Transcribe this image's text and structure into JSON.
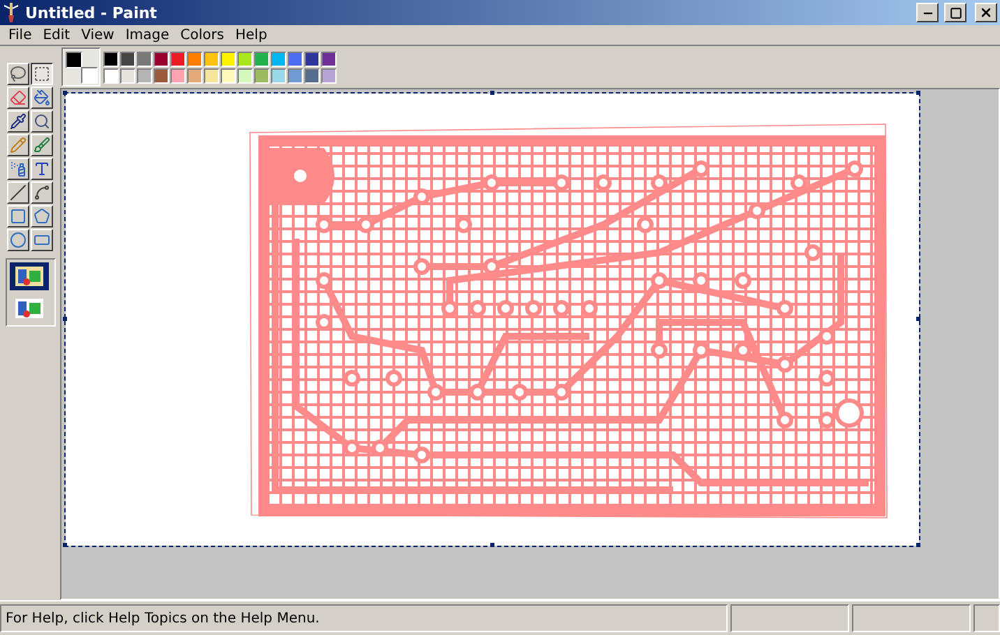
{
  "window": {
    "title": "Untitled - Paint"
  },
  "menu": [
    "File",
    "Edit",
    "View",
    "Image",
    "Colors",
    "Help"
  ],
  "tools": [
    {
      "kind": "free-select",
      "selected": false
    },
    {
      "kind": "select",
      "selected": true
    },
    {
      "kind": "eraser",
      "selected": false
    },
    {
      "kind": "fill",
      "selected": false
    },
    {
      "kind": "picker",
      "selected": false
    },
    {
      "kind": "magnifier",
      "selected": false
    },
    {
      "kind": "pencil",
      "selected": false
    },
    {
      "kind": "brush",
      "selected": false
    },
    {
      "kind": "airbrush",
      "selected": false
    },
    {
      "kind": "text",
      "selected": false
    },
    {
      "kind": "line",
      "selected": false
    },
    {
      "kind": "curve",
      "selected": false
    },
    {
      "kind": "rectangle",
      "selected": false
    },
    {
      "kind": "polygon",
      "selected": false
    },
    {
      "kind": "ellipse",
      "selected": false
    },
    {
      "kind": "rounded-rectangle",
      "selected": false
    }
  ],
  "tool_options": [
    {
      "selected": true
    },
    {
      "selected": false
    }
  ],
  "palette": [
    {
      "color": "#000000"
    },
    {
      "color": "#464646"
    },
    {
      "color": "#787878"
    },
    {
      "color": "#990030"
    },
    {
      "color": "#ed1c24"
    },
    {
      "color": "#ff7e00"
    },
    {
      "color": "#ffc20e"
    },
    {
      "color": "#fff200"
    },
    {
      "color": "#a8e61d"
    },
    {
      "color": "#22b14c"
    },
    {
      "color": "#00b7ef"
    },
    {
      "color": "#4d6df3"
    },
    {
      "color": "#2f3699"
    },
    {
      "color": "#6f3198"
    },
    {
      "color": "#ffffff"
    },
    {
      "color": "#e6e2dd"
    },
    {
      "color": "#b4b4b4"
    },
    {
      "color": "#9c5a3c"
    },
    {
      "color": "#ffa3b1"
    },
    {
      "color": "#e5aa7a"
    },
    {
      "color": "#f5e49c"
    },
    {
      "color": "#fff9bd"
    },
    {
      "color": "#d3f9bc"
    },
    {
      "color": "#9dbb61"
    },
    {
      "color": "#99d9ea"
    },
    {
      "color": "#709ad1"
    },
    {
      "color": "#546d8e"
    },
    {
      "color": "#b5a5d5"
    }
  ],
  "status_bar": {
    "text": "For Help, click Help Topics on the Help Menu."
  }
}
